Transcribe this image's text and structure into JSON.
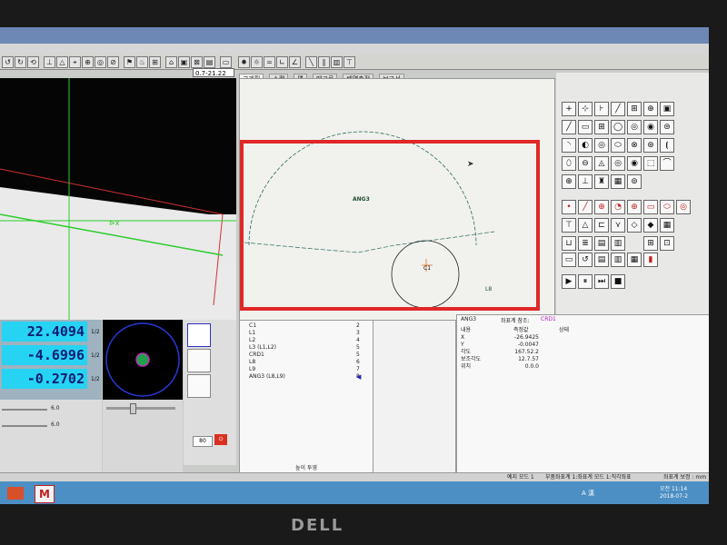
{
  "window": {
    "title": "",
    "menu": "",
    "zoom_combo": "0.7-21.22"
  },
  "tabs": [
    "그래픽",
    "스캔",
    "맵",
    "매크로",
    "배열측정",
    "보고서"
  ],
  "graphics": {
    "labels": {
      "arc": "ANG3",
      "circle": "C1",
      "line_l8": "L8",
      "line_l9": "L9"
    }
  },
  "dro": {
    "x": "22.4094",
    "y": "-4.6996",
    "z": "-0.2702",
    "unit": "1/2"
  },
  "controls": {
    "slider_left_value_1": "6.0",
    "slider_left_value_2": "6.0",
    "slider_mid_value": "80"
  },
  "feature_list": {
    "items": [
      {
        "name": "C1",
        "num": "2"
      },
      {
        "name": "L1",
        "num": "3"
      },
      {
        "name": "L2",
        "num": "4"
      },
      {
        "name": "L3 (L1,L2)",
        "num": "5"
      },
      {
        "name": "CRD1",
        "num": "5"
      },
      {
        "name": "L8",
        "num": "6"
      },
      {
        "name": "L9",
        "num": "7"
      },
      {
        "name": "ANG3 (L8,L9)",
        "num": "8"
      }
    ],
    "footer": "높이 투영"
  },
  "results": {
    "feature": "ANG3",
    "coord_label": "좌표계 참조:",
    "coord_value": "CRD1",
    "headers": [
      "내용",
      "측정값",
      "상태"
    ],
    "rows": [
      {
        "label": "X",
        "value": "-26.9425"
      },
      {
        "label": "Y",
        "value": "-0.0047"
      },
      {
        "label": "각도",
        "value": "167.52.2"
      },
      {
        "label": "보조각도",
        "value": "12.7.57"
      },
      {
        "label": "위치",
        "value": "0.0.0"
      }
    ]
  },
  "statusbar": {
    "mode": "예지 모드 1",
    "coord": "부품좌표계 1:좌표계 모드 1:직각좌표",
    "extra": "좌표계 보정 : mm"
  },
  "taskbar": {
    "ime": "A 漢",
    "time": "오전 11:14",
    "date": "2018-07-2"
  },
  "monitor_brand": "DELL",
  "colors": {
    "highlight": "#e02828",
    "dro_bg": "#26d3f2",
    "dro_text": "#0b1c77",
    "taskbar": "#4c8fc4"
  }
}
